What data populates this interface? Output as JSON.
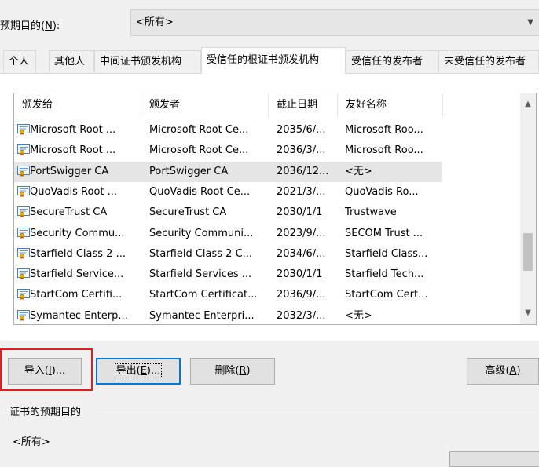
{
  "purpose": {
    "label": "预期目的(N):",
    "label_prefix": "预期目的(",
    "label_key": "N",
    "label_suffix": "):",
    "selected": "<所有>"
  },
  "tabs": [
    {
      "label": "个人"
    },
    {
      "label": "其他人"
    },
    {
      "label": "中间证书颁发机构"
    },
    {
      "label": "受信任的根证书颁发机构"
    },
    {
      "label": "受信任的发布者"
    },
    {
      "label": "未受信任的发布者"
    }
  ],
  "active_tab": "受信任的根证书颁发机构",
  "columns": [
    "颁发给",
    "颁发者",
    "截止日期",
    "友好名称"
  ],
  "rows": [
    {
      "issued_to": "Microsoft Root ...",
      "issued_by": "Microsoft Root Ce...",
      "expires": "2035/6/...",
      "friendly": "Microsoft Roo..."
    },
    {
      "issued_to": "Microsoft Root ...",
      "issued_by": "Microsoft Root Ce...",
      "expires": "2036/3/...",
      "friendly": "Microsoft Roo..."
    },
    {
      "issued_to": "PortSwigger CA",
      "issued_by": "PortSwigger CA",
      "expires": "2036/12...",
      "friendly": "<无>",
      "selected": true
    },
    {
      "issued_to": "QuoVadis Root ...",
      "issued_by": "QuoVadis Root Ce...",
      "expires": "2021/3/...",
      "friendly": "QuoVadis Ro..."
    },
    {
      "issued_to": "SecureTrust CA",
      "issued_by": "SecureTrust CA",
      "expires": "2030/1/1",
      "friendly": "Trustwave"
    },
    {
      "issued_to": "Security Commu...",
      "issued_by": "Security Communi...",
      "expires": "2023/9/...",
      "friendly": "SECOM Trust ..."
    },
    {
      "issued_to": "Starfield Class 2 ...",
      "issued_by": "Starfield Class 2 C...",
      "expires": "2034/6/...",
      "friendly": "Starfield Class..."
    },
    {
      "issued_to": "Starfield Service...",
      "issued_by": "Starfield Services ...",
      "expires": "2030/1/1",
      "friendly": "Starfield Tech..."
    },
    {
      "issued_to": "StartCom Certifi...",
      "issued_by": "StartCom Certificat...",
      "expires": "2036/9/...",
      "friendly": "StartCom Cert..."
    },
    {
      "issued_to": "Symantec Enterp...",
      "issued_by": "Symantec Enterpri...",
      "expires": "2032/3/...",
      "friendly": "<无>"
    }
  ],
  "scrollbar": {
    "position_fraction": 0.78
  },
  "buttons": {
    "import": {
      "prefix": "导入(",
      "key": "I",
      "suffix": ")..."
    },
    "export": {
      "prefix": "导出(",
      "key": "E",
      "suffix": ")..."
    },
    "delete": {
      "prefix": "删除(",
      "key": "R",
      "suffix": ")"
    },
    "advanced": {
      "prefix": "高级(",
      "key": "A",
      "suffix": ")"
    }
  },
  "purpose_group": {
    "title": "证书的预期目的",
    "value": "<所有>"
  },
  "colors": {
    "highlight": "#e02020",
    "focus": "#0078d7",
    "selected_row": "#e5e5e5"
  }
}
